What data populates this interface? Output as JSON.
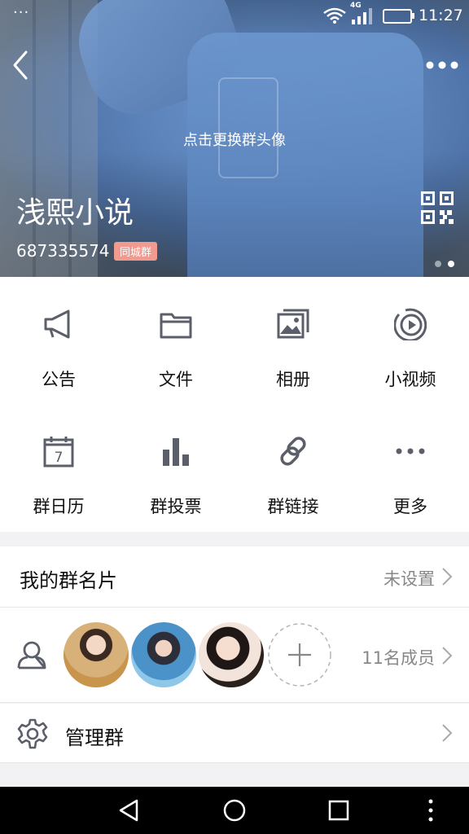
{
  "status_bar": {
    "left": "···",
    "network": "4G",
    "time": "11:27"
  },
  "header": {
    "change_avatar_hint": "点击更换群头像",
    "group_name": "浅熙小说",
    "group_id": "687335574",
    "badge": "同城群"
  },
  "features": [
    {
      "label": "公告",
      "icon": "megaphone-icon"
    },
    {
      "label": "文件",
      "icon": "folder-icon"
    },
    {
      "label": "相册",
      "icon": "album-icon"
    },
    {
      "label": "小视频",
      "icon": "video-icon"
    },
    {
      "label": "群日历",
      "icon": "calendar-icon",
      "day": "7"
    },
    {
      "label": "群投票",
      "icon": "bar-chart-icon"
    },
    {
      "label": "群链接",
      "icon": "link-icon"
    },
    {
      "label": "更多",
      "icon": "more-icon"
    }
  ],
  "my_card": {
    "title": "我的群名片",
    "value": "未设置"
  },
  "members": {
    "count_label": "11名成员"
  },
  "manage": {
    "title": "管理群"
  },
  "colors": {
    "icon_gray": "#5b5f69",
    "badge": "#f39a8f"
  }
}
